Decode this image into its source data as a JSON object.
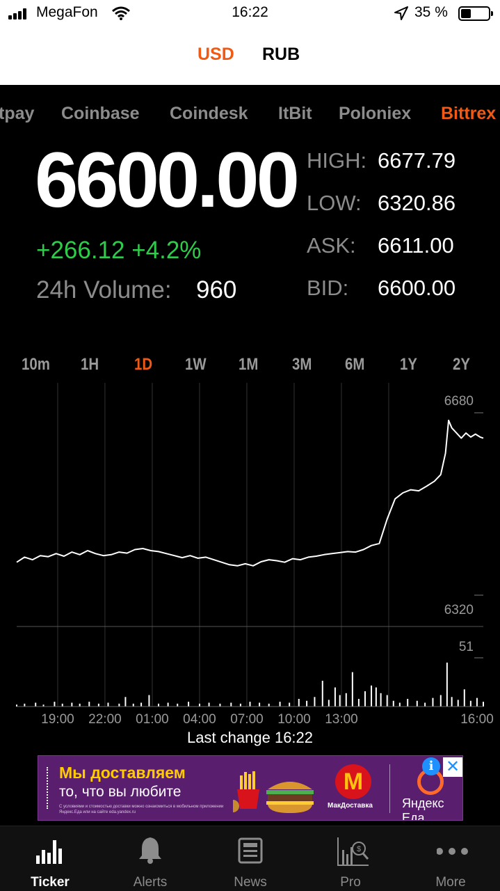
{
  "status_bar": {
    "carrier": "MegaFon",
    "time": "16:22",
    "battery_pct": "35 %",
    "battery_level": 0.35
  },
  "currency_tabs": [
    {
      "label": "USD",
      "active": true
    },
    {
      "label": "RUB",
      "active": false
    }
  ],
  "exchanges": [
    {
      "label": "tpay",
      "active": false
    },
    {
      "label": "Coinbase",
      "active": false
    },
    {
      "label": "Coindesk",
      "active": false
    },
    {
      "label": "ItBit",
      "active": false
    },
    {
      "label": "Poloniex",
      "active": false
    },
    {
      "label": "Bittrex",
      "active": true
    }
  ],
  "ticker": {
    "price": "6600.00",
    "change": "+266.12 +4.2%",
    "volume_label": "24h Volume:",
    "volume_value": "960",
    "stats": [
      {
        "label": "HIGH:",
        "value": "6677.79"
      },
      {
        "label": "LOW:",
        "value": "6320.86"
      },
      {
        "label": "ASK:",
        "value": "6611.00"
      },
      {
        "label": "BID:",
        "value": "6600.00"
      }
    ]
  },
  "timeframes": [
    "10m",
    "1H",
    "1D",
    "1W",
    "1M",
    "3M",
    "6M",
    "1Y",
    "2Y"
  ],
  "active_timeframe": "1D",
  "chart_data": {
    "type": "line",
    "y_top_label": "6680",
    "y_bottom_label": "6320",
    "volume_max_label": "51",
    "x_labels": [
      "19:00",
      "22:00",
      "01:00",
      "04:00",
      "07:00",
      "10:00",
      "13:00",
      "16:00"
    ],
    "price_points": [
      [
        16.4,
        6385
      ],
      [
        16.9,
        6395
      ],
      [
        17.4,
        6390
      ],
      [
        17.9,
        6398
      ],
      [
        18.4,
        6396
      ],
      [
        18.9,
        6402
      ],
      [
        19.4,
        6397
      ],
      [
        19.9,
        6405
      ],
      [
        20.4,
        6400
      ],
      [
        20.9,
        6408
      ],
      [
        21.4,
        6402
      ],
      [
        21.9,
        6398
      ],
      [
        22.4,
        6400
      ],
      [
        22.9,
        6405
      ],
      [
        23.4,
        6403
      ],
      [
        23.9,
        6410
      ],
      [
        24.4,
        6412
      ],
      [
        24.9,
        6408
      ],
      [
        25.4,
        6406
      ],
      [
        25.9,
        6402
      ],
      [
        26.4,
        6398
      ],
      [
        26.9,
        6394
      ],
      [
        27.4,
        6398
      ],
      [
        27.9,
        6393
      ],
      [
        28.4,
        6395
      ],
      [
        28.9,
        6390
      ],
      [
        29.4,
        6385
      ],
      [
        29.9,
        6380
      ],
      [
        30.4,
        6378
      ],
      [
        30.9,
        6382
      ],
      [
        31.4,
        6378
      ],
      [
        31.9,
        6386
      ],
      [
        32.4,
        6390
      ],
      [
        32.9,
        6388
      ],
      [
        33.4,
        6385
      ],
      [
        33.9,
        6392
      ],
      [
        34.4,
        6390
      ],
      [
        34.9,
        6395
      ],
      [
        35.4,
        6397
      ],
      [
        35.9,
        6400
      ],
      [
        36.4,
        6402
      ],
      [
        36.9,
        6404
      ],
      [
        37.4,
        6406
      ],
      [
        37.9,
        6405
      ],
      [
        38.4,
        6410
      ],
      [
        38.9,
        6418
      ],
      [
        39.4,
        6422
      ],
      [
        39.9,
        6470
      ],
      [
        40.4,
        6510
      ],
      [
        40.9,
        6522
      ],
      [
        41.4,
        6528
      ],
      [
        41.9,
        6526
      ],
      [
        42.4,
        6535
      ],
      [
        42.9,
        6545
      ],
      [
        43.3,
        6558
      ],
      [
        43.6,
        6600
      ],
      [
        43.8,
        6665
      ],
      [
        44.0,
        6650
      ],
      [
        44.3,
        6640
      ],
      [
        44.6,
        6630
      ],
      [
        44.9,
        6640
      ],
      [
        45.2,
        6632
      ],
      [
        45.5,
        6638
      ],
      [
        45.8,
        6632
      ],
      [
        46.0,
        6630
      ]
    ],
    "volume_bars": [
      [
        16.4,
        2
      ],
      [
        16.9,
        3
      ],
      [
        17.6,
        4
      ],
      [
        18.1,
        2
      ],
      [
        18.8,
        5
      ],
      [
        19.3,
        3
      ],
      [
        19.9,
        4
      ],
      [
        20.4,
        3
      ],
      [
        21.0,
        5
      ],
      [
        21.6,
        3
      ],
      [
        22.2,
        4
      ],
      [
        22.9,
        3
      ],
      [
        23.3,
        10
      ],
      [
        23.8,
        3
      ],
      [
        24.3,
        4
      ],
      [
        24.8,
        12
      ],
      [
        25.4,
        3
      ],
      [
        26.0,
        4
      ],
      [
        26.6,
        3
      ],
      [
        27.3,
        5
      ],
      [
        28.0,
        3
      ],
      [
        28.6,
        4
      ],
      [
        29.3,
        3
      ],
      [
        30.0,
        4
      ],
      [
        30.6,
        3
      ],
      [
        31.2,
        5
      ],
      [
        31.8,
        4
      ],
      [
        32.4,
        3
      ],
      [
        33.1,
        5
      ],
      [
        33.7,
        4
      ],
      [
        34.3,
        8
      ],
      [
        34.8,
        6
      ],
      [
        35.3,
        10
      ],
      [
        35.8,
        27
      ],
      [
        36.2,
        7
      ],
      [
        36.6,
        20
      ],
      [
        36.9,
        12
      ],
      [
        37.3,
        14
      ],
      [
        37.7,
        36
      ],
      [
        38.1,
        8
      ],
      [
        38.5,
        16
      ],
      [
        38.9,
        22
      ],
      [
        39.2,
        20
      ],
      [
        39.5,
        14
      ],
      [
        39.9,
        12
      ],
      [
        40.3,
        6
      ],
      [
        40.7,
        4
      ],
      [
        41.2,
        8
      ],
      [
        41.8,
        6
      ],
      [
        42.3,
        4
      ],
      [
        42.8,
        9
      ],
      [
        43.3,
        12
      ],
      [
        43.7,
        46
      ],
      [
        44.0,
        10
      ],
      [
        44.4,
        7
      ],
      [
        44.8,
        18
      ],
      [
        45.2,
        6
      ],
      [
        45.6,
        9
      ],
      [
        46.0,
        5
      ]
    ]
  },
  "last_change": "Last change 16:22",
  "ad": {
    "line1": "Мы доставляем",
    "line2": "то, что вы любите",
    "small_print": "С условиями и стоимостью доставки можно ознакомиться в мобильном приложении Яндекс.Еда или на сайте eda.yandex.ru",
    "mcd_label": "МакДоставка",
    "yandex_label": "Яндекс Еда"
  },
  "tabs": [
    {
      "label": "Ticker",
      "icon": "bar-chart-icon",
      "active": true
    },
    {
      "label": "Alerts",
      "icon": "bell-icon",
      "active": false
    },
    {
      "label": "News",
      "icon": "newspaper-icon",
      "active": false
    },
    {
      "label": "Pro",
      "icon": "pro-chart-icon",
      "active": false
    },
    {
      "label": "More",
      "icon": "more-dots-icon",
      "active": false
    }
  ],
  "colors": {
    "accent": "#f05a14",
    "positive": "#2ecc4a",
    "background": "#000000",
    "muted": "#8c8c8c"
  }
}
